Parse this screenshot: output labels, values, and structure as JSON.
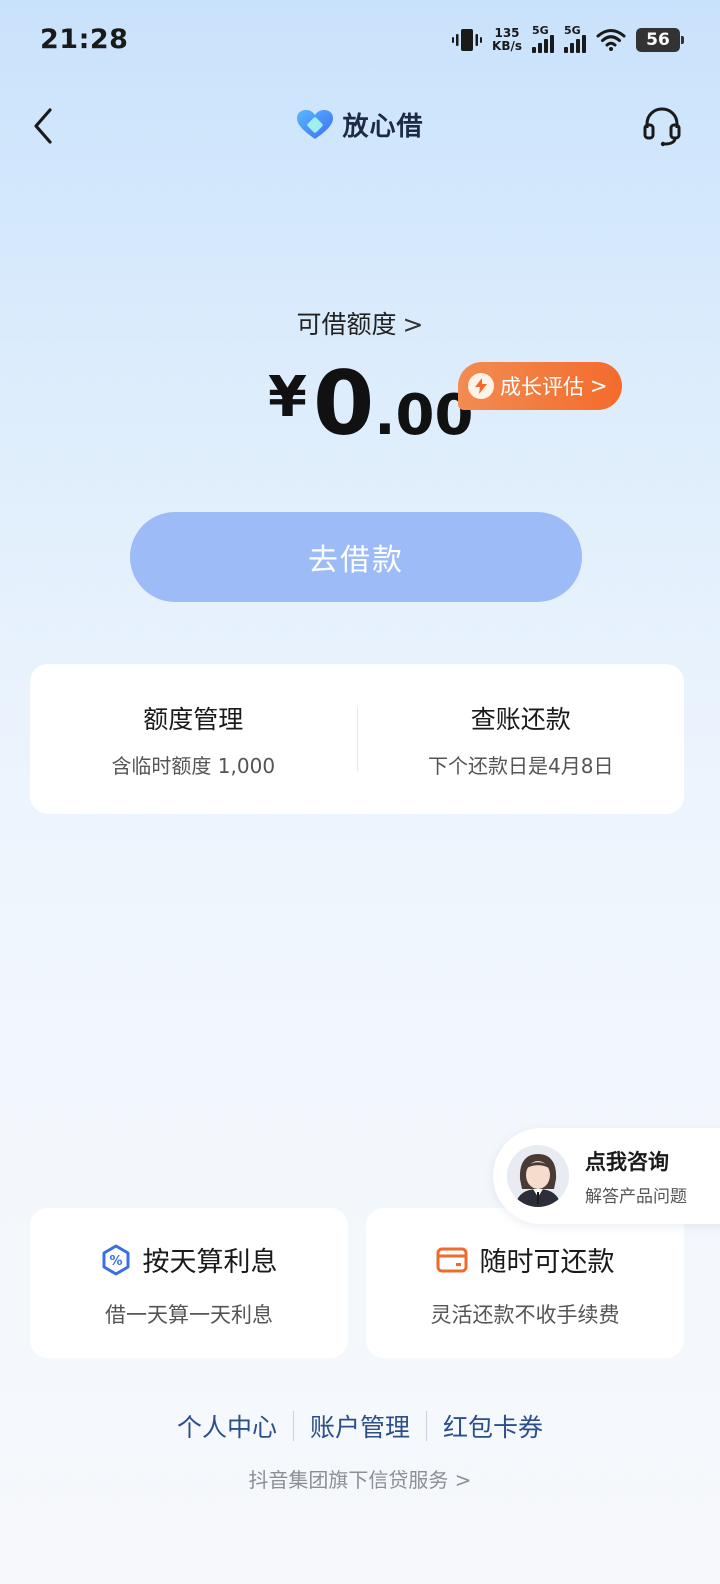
{
  "status_bar": {
    "time": "21:28",
    "net_speed_value": "135",
    "net_speed_unit": "KB/s",
    "signal1_label": "5G",
    "signal2_label": "5G",
    "battery": "56"
  },
  "nav": {
    "back_icon": "chevron-left-icon",
    "brand_name": "放心借",
    "support_icon": "headset-icon"
  },
  "credit": {
    "label": "可借额度",
    "label_chevron": ">",
    "currency": "¥",
    "amount_int": "0",
    "amount_dec": ".00",
    "growth_label": "成长评估",
    "growth_chevron": ">"
  },
  "borrow_button": "去借款",
  "management": {
    "quota_title": "额度管理",
    "quota_sub": "含临时额度 1,000",
    "bill_title": "查账还款",
    "bill_sub": "下个还款日是4月8日"
  },
  "consult": {
    "title": "点我咨询",
    "subtitle": "解答产品问题"
  },
  "features": [
    {
      "title": "按天算利息",
      "subtitle": "借一天算一天利息",
      "icon": "percent-hexagon-icon"
    },
    {
      "title": "随时可还款",
      "subtitle": "灵活还款不收手续费",
      "icon": "wallet-icon"
    }
  ],
  "footer": {
    "links": [
      "个人中心",
      "账户管理",
      "红包卡券"
    ],
    "note": "抖音集团旗下信贷服务",
    "note_chevron": ">"
  },
  "colors": {
    "accent_orange": "#f36b2c",
    "borrow_button": "#9dbbf7",
    "link_blue": "#2b4f8c"
  }
}
